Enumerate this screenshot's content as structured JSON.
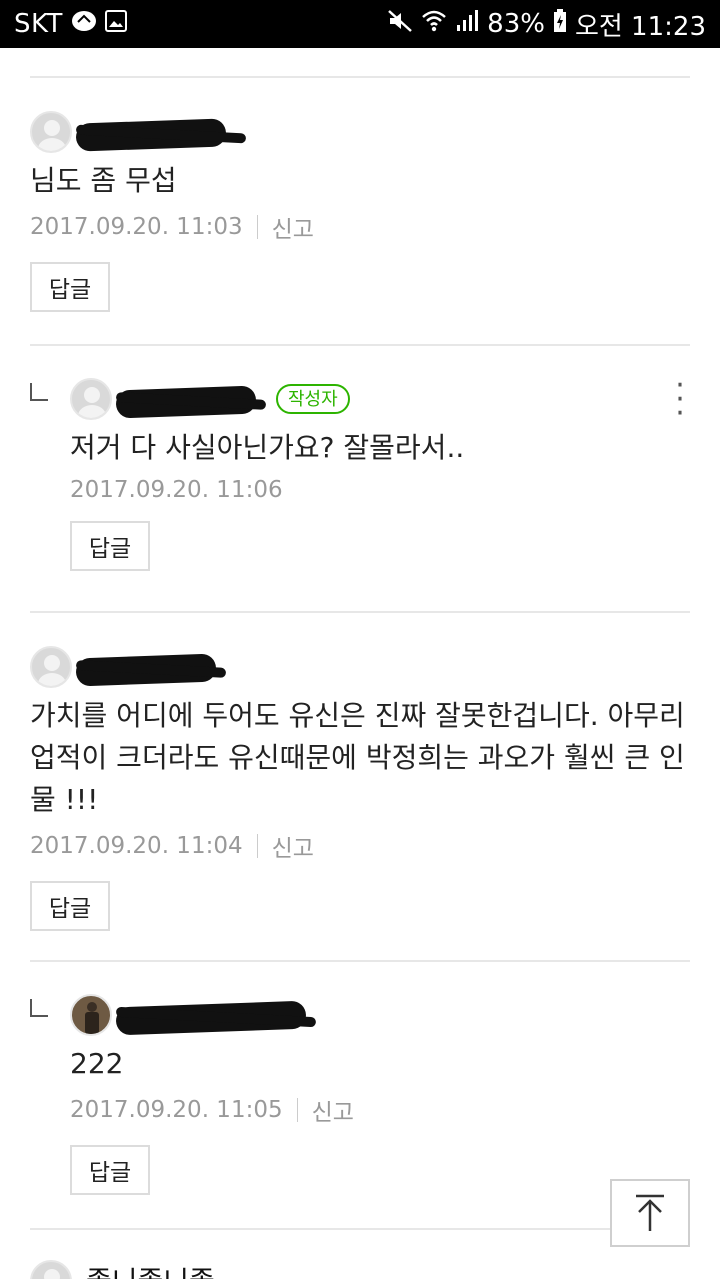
{
  "status_bar": {
    "carrier": "SKT",
    "battery": "83%",
    "time": "오전 11:23"
  },
  "comments": [
    {
      "text": "님도 좀 무섭",
      "date": "2017.09.20. 11:03",
      "report": "신고",
      "reply_label": "답글"
    },
    {
      "is_reply": true,
      "author_badge": "작성자",
      "text": "저거 다 사실아닌가요? 잘몰라서..",
      "date": "2017.09.20. 11:06",
      "reply_label": "답글"
    },
    {
      "text": "가치를 어디에 두어도 유신은 진짜 잘못한겁니다. 아무리 업적이 크더라도 유신때문에 박정희는 과오가 훨씬 큰 인물 !!!",
      "date": "2017.09.20. 11:04",
      "report": "신고",
      "reply_label": "답글"
    },
    {
      "is_reply": true,
      "text": "222",
      "date": "2017.09.20. 11:05",
      "report": "신고",
      "reply_label": "답글"
    }
  ],
  "next_comment": {
    "nick_partial": "좋니좋니좋"
  }
}
